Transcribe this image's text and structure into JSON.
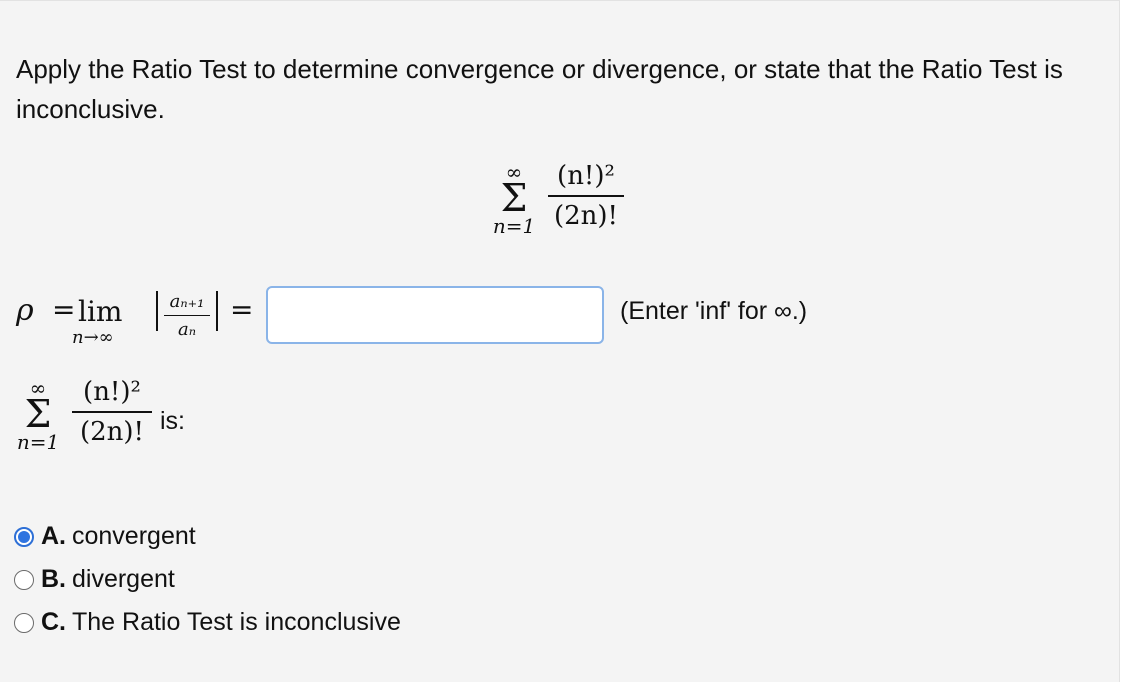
{
  "question": {
    "text": "Apply the Ratio Test to determine convergence or divergence, or state that the Ratio Test is inconclusive."
  },
  "series": {
    "upper_limit": "∞",
    "sigma": "Σ",
    "lower_limit": "n=1",
    "numerator": "(n!)²",
    "denominator": "(2n)!"
  },
  "ratio": {
    "rho": "ρ",
    "equals": "=",
    "lim": "lim",
    "lim_sub": "n→∞",
    "frac_num": "aₙ₊₁",
    "frac_den": "aₙ",
    "input_value": "",
    "hint": "(Enter 'inf' for ∞.)"
  },
  "series_is_label": "is:",
  "options": [
    {
      "letter": "A.",
      "text": "convergent",
      "selected": true
    },
    {
      "letter": "B.",
      "text": "divergent",
      "selected": false
    },
    {
      "letter": "C.",
      "text": "The Ratio Test is inconclusive",
      "selected": false
    }
  ],
  "colors": {
    "panel_bg": "#f4f4f4",
    "radio_selected": "#2f74e0",
    "input_border": "#8ab4e8"
  }
}
